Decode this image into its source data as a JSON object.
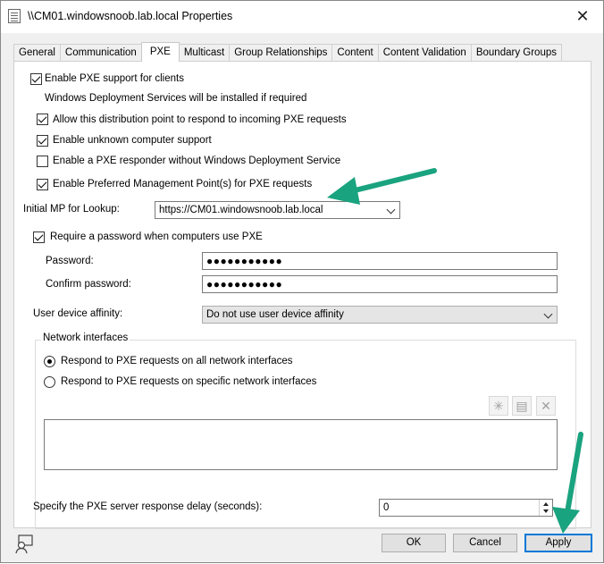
{
  "window": {
    "title": "\\\\CM01.windowsnoob.lab.local Properties",
    "close_glyph": "✕"
  },
  "tabs": [
    {
      "label": "General"
    },
    {
      "label": "Communication"
    },
    {
      "label": "PXE",
      "active": true
    },
    {
      "label": "Multicast"
    },
    {
      "label": "Group Relationships"
    },
    {
      "label": "Content"
    },
    {
      "label": "Content Validation"
    },
    {
      "label": "Boundary Groups"
    }
  ],
  "pxe": {
    "enable_pxe": {
      "label": "Enable PXE support for clients",
      "checked": true
    },
    "wds_note": "Windows Deployment Services will be installed if required",
    "allow_respond": {
      "label": "Allow this distribution point to respond to incoming PXE requests",
      "checked": true
    },
    "unknown_support": {
      "label": "Enable unknown computer support",
      "checked": true
    },
    "responder_without_wds": {
      "label": "Enable a PXE responder without Windows Deployment Service",
      "checked": false
    },
    "preferred_mp": {
      "label": "Enable Preferred Management Point(s) for PXE requests",
      "checked": true
    },
    "initial_mp_label": "Initial MP for Lookup:",
    "initial_mp_value": "https://CM01.windowsnoob.lab.local",
    "require_password": {
      "label": "Require a password when computers use PXE",
      "checked": true
    },
    "password_label": "Password:",
    "password_value": "●●●●●●●●●●●",
    "confirm_label": "Confirm password:",
    "confirm_value": "●●●●●●●●●●●",
    "affinity_label": "User device affinity:",
    "affinity_value": "Do not use user device affinity",
    "network_group_label": "Network interfaces",
    "radio_all": {
      "label": "Respond to PXE requests on all network interfaces",
      "checked": true
    },
    "radio_specific": {
      "label": "Respond to PXE requests on specific network interfaces",
      "checked": false
    },
    "delay_label": "Specify the PXE server response delay (seconds):",
    "delay_value": "0"
  },
  "footer": {
    "ok": "OK",
    "cancel": "Cancel",
    "apply": "Apply"
  },
  "colors": {
    "annotation_arrow": "#1aa37f",
    "default_button_border": "#0078d7"
  }
}
